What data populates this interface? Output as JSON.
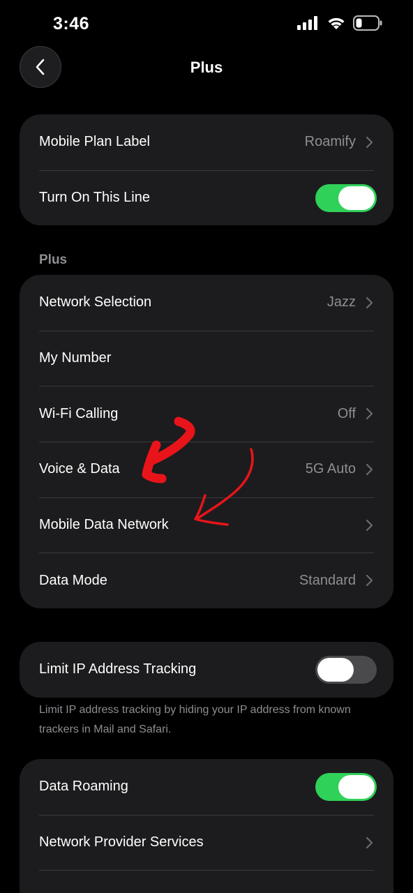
{
  "status_bar": {
    "time": "3:46",
    "icons": [
      "cellular-signal-icon",
      "wifi-icon",
      "battery-icon"
    ]
  },
  "nav": {
    "title": "Plus",
    "back_icon": "chevron-left-icon"
  },
  "group1": {
    "rows": [
      {
        "label": "Mobile Plan Label",
        "value": "Roamify"
      },
      {
        "label": "Turn On This Line",
        "toggle": "on"
      }
    ]
  },
  "section": {
    "header": "Plus"
  },
  "group2": {
    "rows": [
      {
        "label": "Network Selection",
        "value": "Jazz"
      },
      {
        "label": "My Number"
      },
      {
        "label": "Wi-Fi Calling",
        "value": "Off"
      },
      {
        "label": "Voice & Data",
        "value": "5G Auto"
      },
      {
        "label": "Mobile Data Network"
      },
      {
        "label": "Data Mode",
        "value": "Standard"
      }
    ]
  },
  "group3": {
    "rows": [
      {
        "label": "Limit IP Address Tracking",
        "toggle": "off"
      }
    ],
    "footer": "Limit IP address tracking by hiding your IP address from known trackers in Mail and Safari."
  },
  "group4": {
    "rows": [
      {
        "label": "Data Roaming",
        "toggle": "on"
      },
      {
        "label": "Network Provider Services"
      }
    ]
  },
  "colors": {
    "background": "#000000",
    "cell": "#1c1c1e",
    "toggle_on": "#30d158",
    "secondary_text": "#8e8e93",
    "annotation": "#e8141a"
  }
}
